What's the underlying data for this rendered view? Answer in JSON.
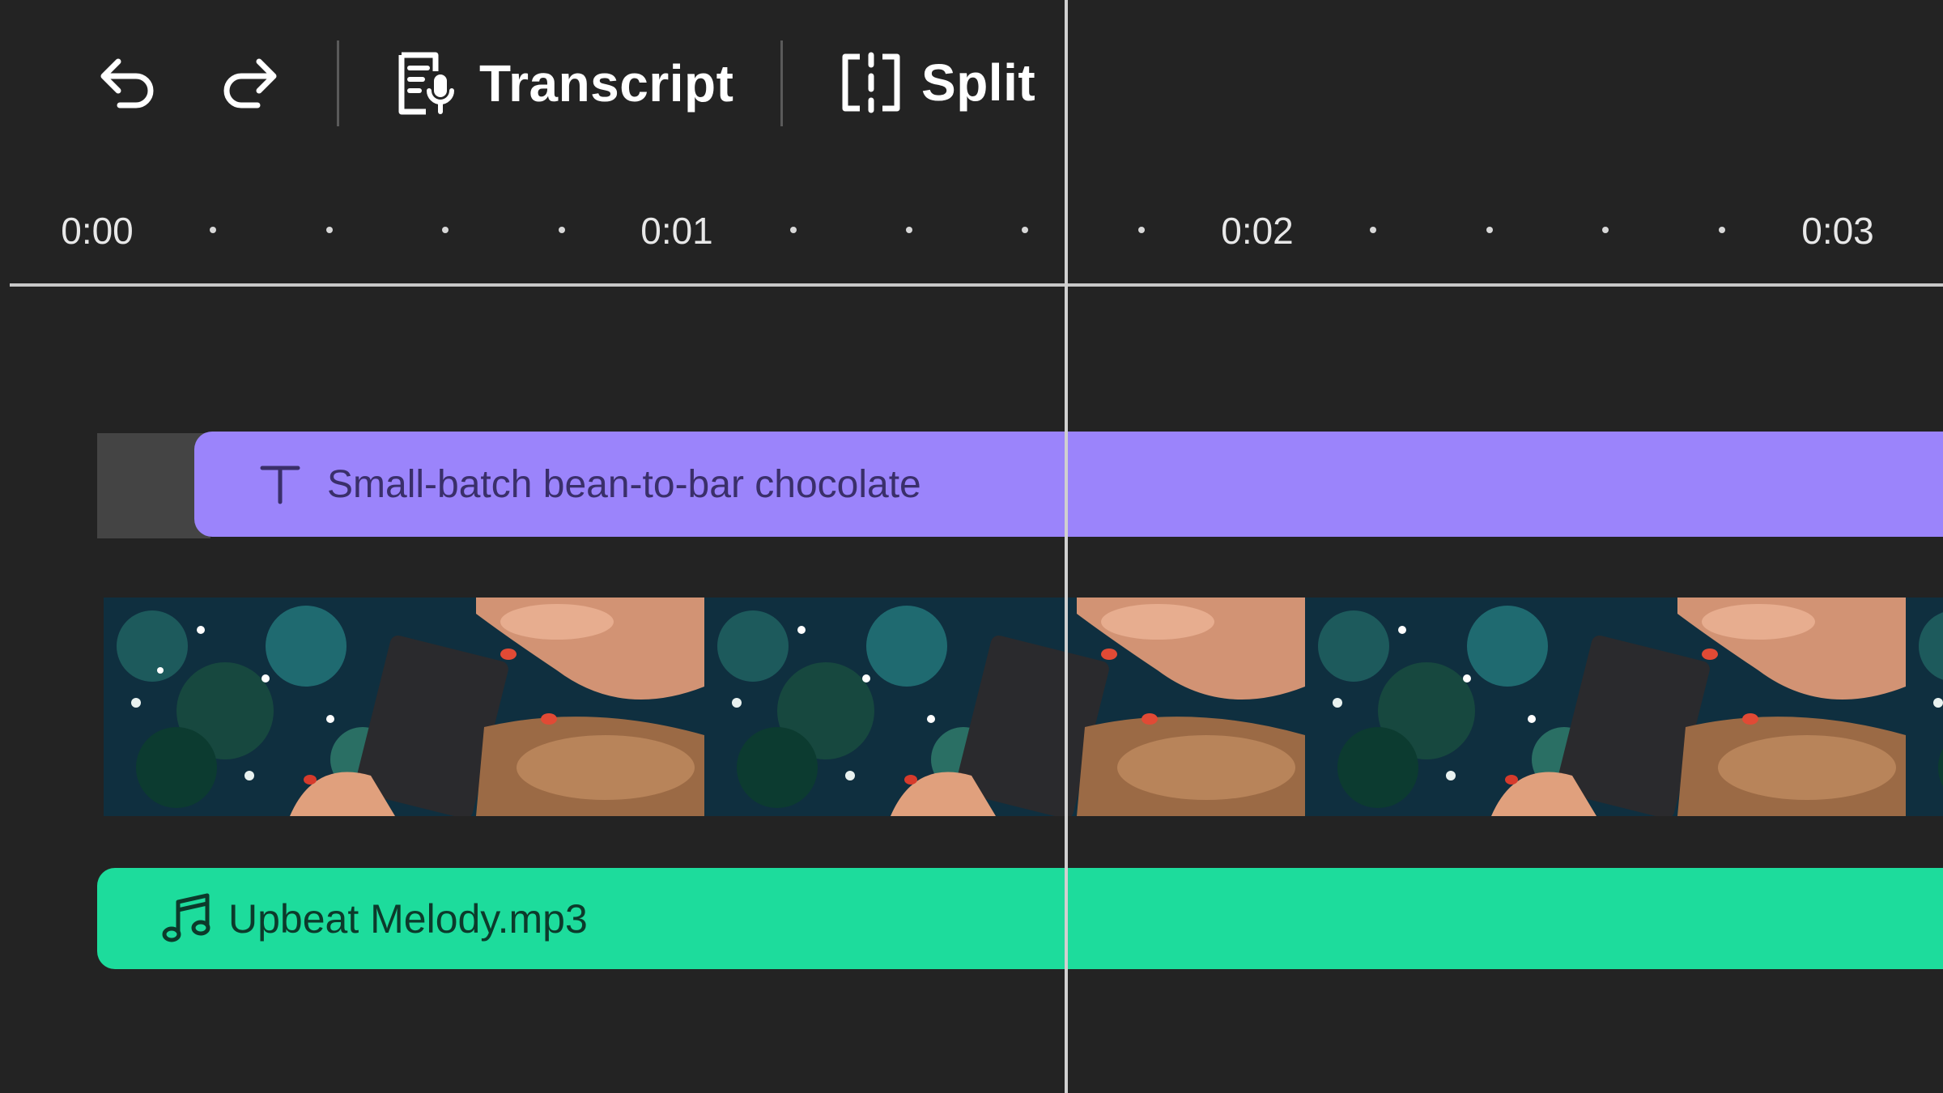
{
  "toolbar": {
    "undo_icon": "undo-icon",
    "redo_icon": "redo-icon",
    "transcript_label": "Transcript",
    "transcript_icon": "transcript-icon",
    "split_label": "Split",
    "split_icon": "split-icon"
  },
  "ruler": {
    "ticks": [
      "0:00",
      "0:01",
      "0:02",
      "0:03"
    ]
  },
  "tracks": {
    "text": {
      "icon": "text-icon",
      "label": "Small-batch bean-to-bar chocolate",
      "color": "#9b84fb"
    },
    "video": {
      "thumbnail_count": 4
    },
    "audio": {
      "icon": "music-note-icon",
      "label": "Upbeat Melody.mp3",
      "color": "#1ddc9c"
    }
  },
  "colors": {
    "background": "#232323",
    "text_track": "#9b84fb",
    "audio_track": "#1ddc9c",
    "playhead": "#d0d0d0"
  }
}
